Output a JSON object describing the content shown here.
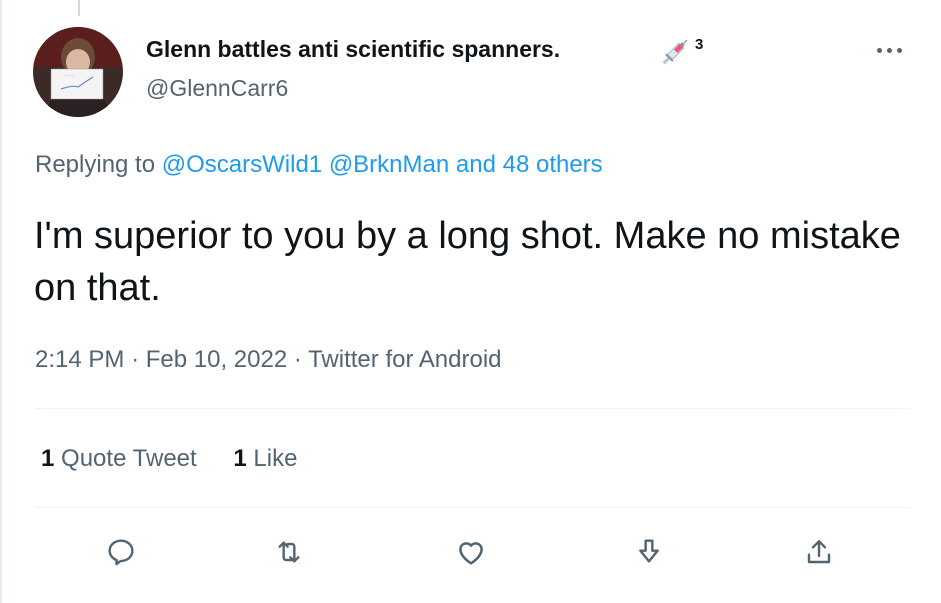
{
  "tweet": {
    "author_name": "Glenn battles anti scientific spanners.",
    "author_emoji_icon": "syringe-icon",
    "author_superscript": "3",
    "author_handle": "@GlennCarr6",
    "replying_prefix": "Replying to",
    "reply_mentions": [
      "@OscarsWild1",
      "@BrknMan"
    ],
    "reply_others": "and 48 others",
    "text": "I'm superior to you by a long shot. Make no mistake on that.",
    "time": "2:14 PM",
    "date": "Feb 10, 2022",
    "source": "Twitter for Android",
    "separator": "·",
    "quote_count": "1",
    "quote_label": "Quote Tweet",
    "like_count": "1",
    "like_label": "Like"
  },
  "icons": {
    "more": "more-horizontal-icon",
    "reply": "reply-icon",
    "retweet": "retweet-icon",
    "like": "heart-icon",
    "downvote": "downvote-icon",
    "share": "share-icon"
  },
  "colors": {
    "link": "#1d9bf0",
    "secondary_text": "#536471",
    "primary_text": "#0f1419"
  }
}
